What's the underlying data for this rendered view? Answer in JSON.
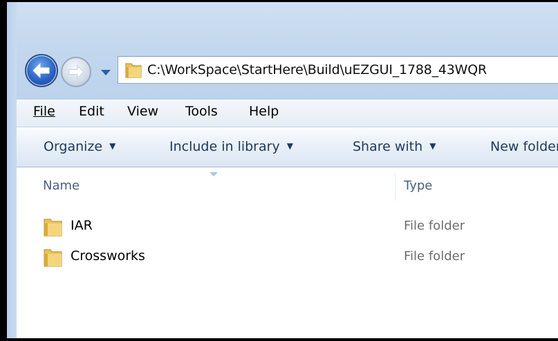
{
  "address": {
    "path": "C:\\WorkSpace\\StartHere\\Build\\uEZGUI_1788_43WQR"
  },
  "menu": {
    "items": [
      "File",
      "Edit",
      "View",
      "Tools",
      "Help"
    ]
  },
  "commands": {
    "organize": "Organize",
    "include_in_library": "Include in library",
    "share_with": "Share with",
    "new_folder": "New folder"
  },
  "columns": {
    "name": "Name",
    "type": "Type"
  },
  "files": [
    {
      "name": "IAR",
      "type": "File folder",
      "icon": "folder-icon"
    },
    {
      "name": "Crossworks",
      "type": "File folder",
      "icon": "folder-icon"
    }
  ],
  "colors": {
    "frame": "#c4d8ef",
    "command_text": "#1e395b",
    "type_text": "#6d6d6d"
  }
}
